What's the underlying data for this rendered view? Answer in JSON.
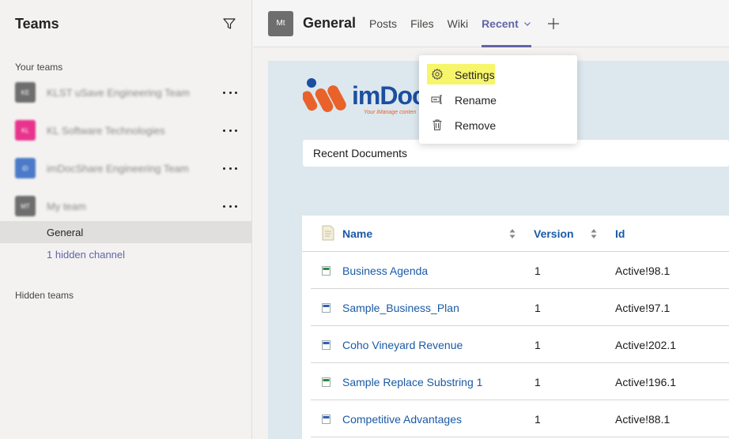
{
  "sidebar": {
    "title": "Teams",
    "your_teams_label": "Your teams",
    "teams": [
      {
        "name": "KLST uSave Engineering Team",
        "avatar_initials": "KE",
        "avatar_color": "#6e6e6e"
      },
      {
        "name": "KL Software Technologies",
        "avatar_initials": "KL",
        "avatar_color": "#e8348c"
      },
      {
        "name": "imDocShare Engineering Team",
        "avatar_initials": "iD",
        "avatar_color": "#4a7ac8"
      },
      {
        "name": "My team",
        "avatar_initials": "MT",
        "avatar_color": "#6e6e6e"
      }
    ],
    "channels": [
      {
        "label": "General"
      },
      {
        "label": "1 hidden channel"
      }
    ],
    "hidden_teams_label": "Hidden teams"
  },
  "header": {
    "avatar_initials": "Mt",
    "channel_title": "General",
    "tabs": [
      {
        "label": "Posts"
      },
      {
        "label": "Files"
      },
      {
        "label": "Wiki"
      },
      {
        "label": "Recent"
      }
    ]
  },
  "menu": {
    "items": [
      {
        "label": "Settings",
        "icon": "gear-icon"
      },
      {
        "label": "Rename",
        "icon": "rename-icon"
      },
      {
        "label": "Remove",
        "icon": "trash-icon"
      }
    ]
  },
  "app": {
    "logo_text": "imDoc",
    "logo_tagline": "Your iManage conten",
    "recent_header": "Recent Documents",
    "columns": [
      "Name",
      "Version",
      "Id"
    ],
    "rows": [
      {
        "name": "Business Agenda",
        "version": "1",
        "id": "Active!98.1",
        "type": "xls"
      },
      {
        "name": "Sample_Business_Plan",
        "version": "1",
        "id": "Active!97.1",
        "type": "doc"
      },
      {
        "name": "Coho Vineyard Revenue",
        "version": "1",
        "id": "Active!202.1",
        "type": "doc"
      },
      {
        "name": "Sample Replace Substring 1",
        "version": "1",
        "id": "Active!196.1",
        "type": "xls"
      },
      {
        "name": "Competitive Advantages",
        "version": "1",
        "id": "Active!88.1",
        "type": "doc"
      }
    ]
  },
  "colors": {
    "accent": "#6264a7",
    "link": "#1a5aa6",
    "highlight": "#f7f56a",
    "content_bg": "#dce7ee"
  }
}
